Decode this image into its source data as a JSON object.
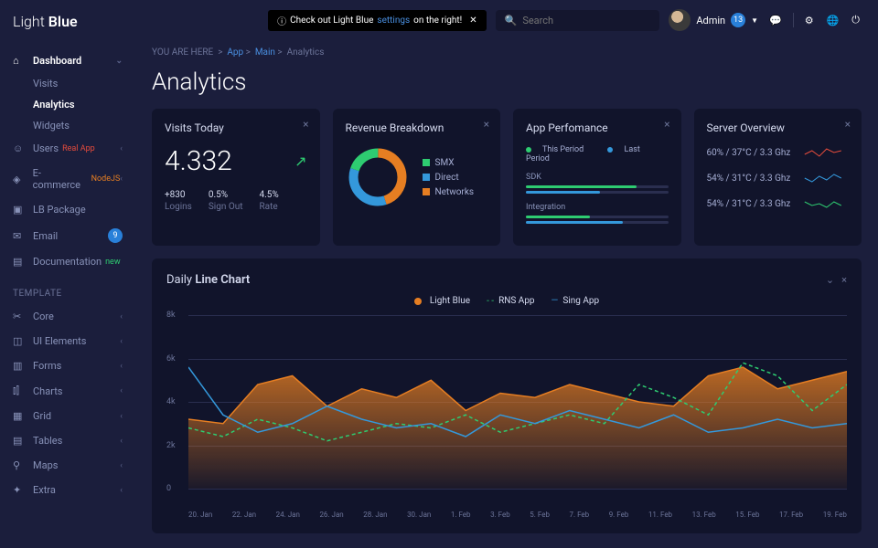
{
  "brand": {
    "part1": "Light",
    "part2": "Blue"
  },
  "topbar": {
    "alert_prefix": "Check out Light Blue",
    "alert_link": "settings",
    "alert_suffix": "on the right!",
    "search_placeholder": "Search",
    "user_name": "Admin",
    "user_badge": "13"
  },
  "breadcrumb": {
    "label": "YOU ARE HERE",
    "p1": "App",
    "p2": "Main",
    "p3": "Analytics"
  },
  "page_title": "Analytics",
  "sidebar": {
    "dashboard": "Dashboard",
    "sub": [
      "Visits",
      "Analytics",
      "Widgets"
    ],
    "users": "Users",
    "users_tag": "Real App",
    "ecommerce": "E-commerce",
    "ecommerce_tag": "NodeJS",
    "lb": "LB Package",
    "email": "Email",
    "email_badge": "9",
    "docs": "Documentation",
    "docs_tag": "new",
    "section": "TEMPLATE",
    "template": [
      "Core",
      "UI Elements",
      "Forms",
      "Charts",
      "Grid",
      "Tables",
      "Maps",
      "Extra"
    ]
  },
  "cards": {
    "visits": {
      "title": "Visits Today",
      "value": "4.332",
      "stats": [
        {
          "v": "+830",
          "l": "Logins"
        },
        {
          "v": "0.5%",
          "l": "Sign Out"
        },
        {
          "v": "4.5%",
          "l": "Rate"
        }
      ]
    },
    "revenue": {
      "title": "Revenue Breakdown",
      "legend": [
        {
          "label": "SMX",
          "color": "#2ecc71"
        },
        {
          "label": "Direct",
          "color": "#3498db"
        },
        {
          "label": "Networks",
          "color": "#e67e22"
        }
      ]
    },
    "perf": {
      "title": "App Perfomance",
      "legend": [
        {
          "label": "This Period",
          "color": "#2ecc71"
        },
        {
          "label": "Last Period",
          "color": "#3498db"
        }
      ],
      "rows": [
        {
          "label": "SDK",
          "this": 78,
          "last": 52
        },
        {
          "label": "Integration",
          "this": 45,
          "last": 68
        }
      ]
    },
    "server": {
      "title": "Server Overview",
      "rows": [
        "60% / 37°C / 3.3 Ghz",
        "54% / 31°C / 3.3 Ghz",
        "54% / 31°C / 3.3 Ghz"
      ]
    }
  },
  "chart": {
    "title_a": "Daily",
    "title_b": "Line Chart",
    "legend": [
      {
        "label": "Light Blue",
        "color": "#e67e22"
      },
      {
        "label": "RNS App",
        "color": "#2ecc71"
      },
      {
        "label": "Sing App",
        "color": "#3498db"
      }
    ]
  },
  "chart_data": {
    "type": "line",
    "ylabel": "",
    "xlabel": "",
    "ylim": [
      0,
      8000
    ],
    "yticks": [
      "0",
      "2k",
      "4k",
      "6k",
      "8k"
    ],
    "x": [
      "20. Jan",
      "22. Jan",
      "24. Jan",
      "26. Jan",
      "28. Jan",
      "30. Jan",
      "1. Feb",
      "3. Feb",
      "5. Feb",
      "7. Feb",
      "9. Feb",
      "11. Feb",
      "13. Feb",
      "15. Feb",
      "17. Feb",
      "19. Feb"
    ],
    "series": [
      {
        "name": "Light Blue",
        "color": "#e67e22",
        "fill": true,
        "values": [
          3200,
          3000,
          4800,
          5200,
          3800,
          4600,
          4200,
          5000,
          3600,
          4400,
          4200,
          4800,
          4400,
          4000,
          3800,
          5200,
          5600,
          4600,
          5000,
          5400
        ]
      },
      {
        "name": "RNS App",
        "color": "#2ecc71",
        "dash": true,
        "values": [
          2800,
          2400,
          3200,
          2800,
          2200,
          2600,
          3000,
          2800,
          3400,
          2600,
          3000,
          3400,
          3000,
          4800,
          4200,
          3400,
          5800,
          5200,
          3600,
          4800
        ]
      },
      {
        "name": "Sing App",
        "color": "#3498db",
        "values": [
          5600,
          3400,
          2600,
          3000,
          3800,
          3200,
          2800,
          3000,
          2400,
          3400,
          3000,
          3600,
          3200,
          2800,
          3400,
          2600,
          2800,
          3200,
          2800,
          3000
        ]
      }
    ],
    "revenue_donut": {
      "SMX": 20,
      "Direct": 35,
      "Networks": 45
    }
  }
}
